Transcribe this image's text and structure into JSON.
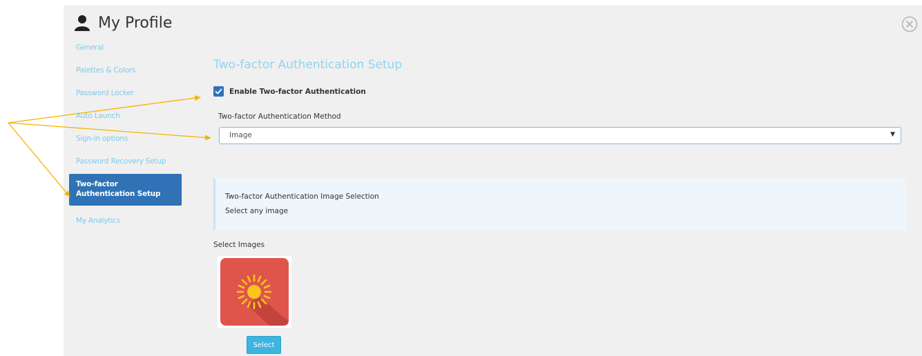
{
  "header": {
    "title": "My Profile",
    "icon": "user-icon"
  },
  "sidebar": {
    "items": [
      {
        "label": "General"
      },
      {
        "label": "Palettes & Colors"
      },
      {
        "label": "Password Locker"
      },
      {
        "label": "Auto Launch"
      },
      {
        "label": "Sign-in options"
      },
      {
        "label": "Password Recovery Setup"
      },
      {
        "label": "Two-factor Authentication Setup",
        "active": true
      },
      {
        "label": "My Analytics"
      }
    ]
  },
  "main": {
    "section_title": "Two-factor Authentication Setup",
    "enable_checkbox": {
      "label": "Enable Two-factor Authentication",
      "checked": true
    },
    "method": {
      "label": "Two-factor Authentication Method",
      "selected": "Image"
    },
    "info_box": {
      "title": "Two-factor Authentication Image Selection",
      "subtitle": "Select any image"
    },
    "images": {
      "label": "Select Images",
      "tile_icon": "sun-icon",
      "select_button": "Select"
    }
  },
  "colors": {
    "accent": "#2f72b6",
    "link": "#7ccbee",
    "button": "#3cb5e0",
    "annotation_arrow": "#f5b400"
  }
}
